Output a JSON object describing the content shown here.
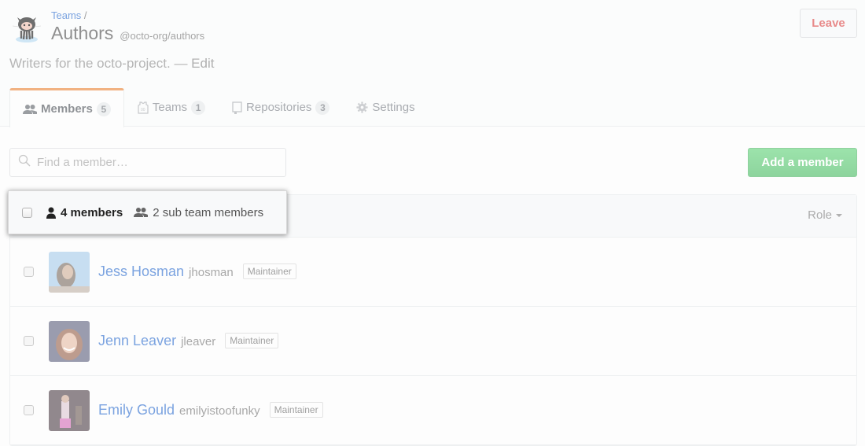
{
  "header": {
    "breadcrumb_parent": "Teams",
    "breadcrumb_separator": "/",
    "team_name": "Authors",
    "team_slug": "@octo-org/authors",
    "description": "Writers for the octo-project.",
    "description_separator": "—",
    "edit_label": "Edit",
    "leave_label": "Leave"
  },
  "tabs": [
    {
      "label": "Members",
      "count": "5",
      "icon": "people-icon",
      "active": true
    },
    {
      "label": "Teams",
      "count": "1",
      "icon": "jersey-icon",
      "active": false
    },
    {
      "label": "Repositories",
      "count": "3",
      "icon": "repo-icon",
      "active": false
    },
    {
      "label": "Settings",
      "count": null,
      "icon": "gear-icon",
      "active": false
    }
  ],
  "search": {
    "placeholder": "Find a member…",
    "value": ""
  },
  "add_member_label": "Add a member",
  "list_header": {
    "members_count_label": "4 members",
    "sub_team_label": "2 sub team members",
    "role_label": "Role"
  },
  "members": [
    {
      "name": "Jess Hosman",
      "login": "jhosman",
      "role": "Maintainer"
    },
    {
      "name": "Jenn Leaver",
      "login": "jleaver",
      "role": "Maintainer"
    },
    {
      "name": "Emily Gould",
      "login": "emilyistoofunky",
      "role": "Maintainer"
    }
  ],
  "colors": {
    "link": "#7ba3e0",
    "tab_active_border": "#f1b282",
    "leave_text": "#e88a8a",
    "add_button": "#94dca5"
  }
}
